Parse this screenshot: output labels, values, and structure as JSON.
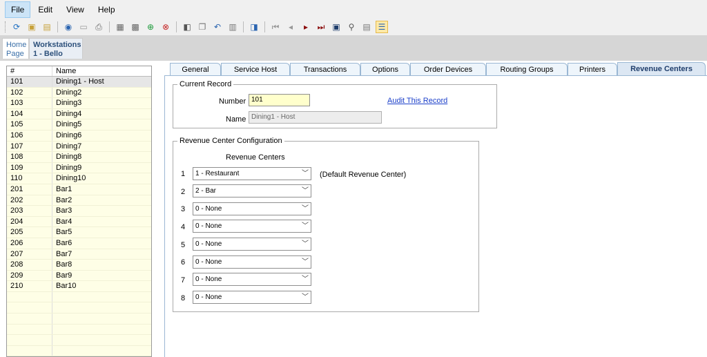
{
  "menu": [
    "File",
    "Edit",
    "View",
    "Help"
  ],
  "breadcrumb": {
    "home_line1": "Home",
    "home_line2": "Page",
    "ws_line1": "Workstations",
    "ws_line2": "1 - Bello"
  },
  "list": {
    "headers": [
      "#",
      "Name"
    ],
    "rows": [
      [
        "101",
        "Dining1 - Host"
      ],
      [
        "102",
        "Dining2"
      ],
      [
        "103",
        "Dining3"
      ],
      [
        "104",
        "Dining4"
      ],
      [
        "105",
        "Dining5"
      ],
      [
        "106",
        "Dining6"
      ],
      [
        "107",
        "Dining7"
      ],
      [
        "108",
        "Dining8"
      ],
      [
        "109",
        "Dining9"
      ],
      [
        "110",
        "Dining10"
      ],
      [
        "201",
        "Bar1"
      ],
      [
        "202",
        "Bar2"
      ],
      [
        "203",
        "Bar3"
      ],
      [
        "204",
        "Bar4"
      ],
      [
        "205",
        "Bar5"
      ],
      [
        "206",
        "Bar6"
      ],
      [
        "207",
        "Bar7"
      ],
      [
        "208",
        "Bar8"
      ],
      [
        "209",
        "Bar9"
      ],
      [
        "210",
        "Bar10"
      ]
    ]
  },
  "tabs": [
    "General",
    "Service Host",
    "Transactions",
    "Options",
    "Order Devices",
    "Routing Groups",
    "Printers",
    "Revenue Centers"
  ],
  "current_record": {
    "legend": "Current Record",
    "number_label": "Number",
    "number_value": "101",
    "name_label": "Name",
    "name_value": "Dining1 - Host",
    "audit_link": "Audit This Record"
  },
  "revenue_config": {
    "legend": "Revenue Center Configuration",
    "column_header": "Revenue Centers",
    "default_note": "(Default Revenue Center)",
    "rows": [
      {
        "n": "1",
        "value": "1 - Restaurant"
      },
      {
        "n": "2",
        "value": "2 - Bar"
      },
      {
        "n": "3",
        "value": "0 - None"
      },
      {
        "n": "4",
        "value": "0 - None"
      },
      {
        "n": "5",
        "value": "0 - None"
      },
      {
        "n": "6",
        "value": "0 - None"
      },
      {
        "n": "7",
        "value": "0 - None"
      },
      {
        "n": "8",
        "value": "0 - None"
      }
    ]
  }
}
